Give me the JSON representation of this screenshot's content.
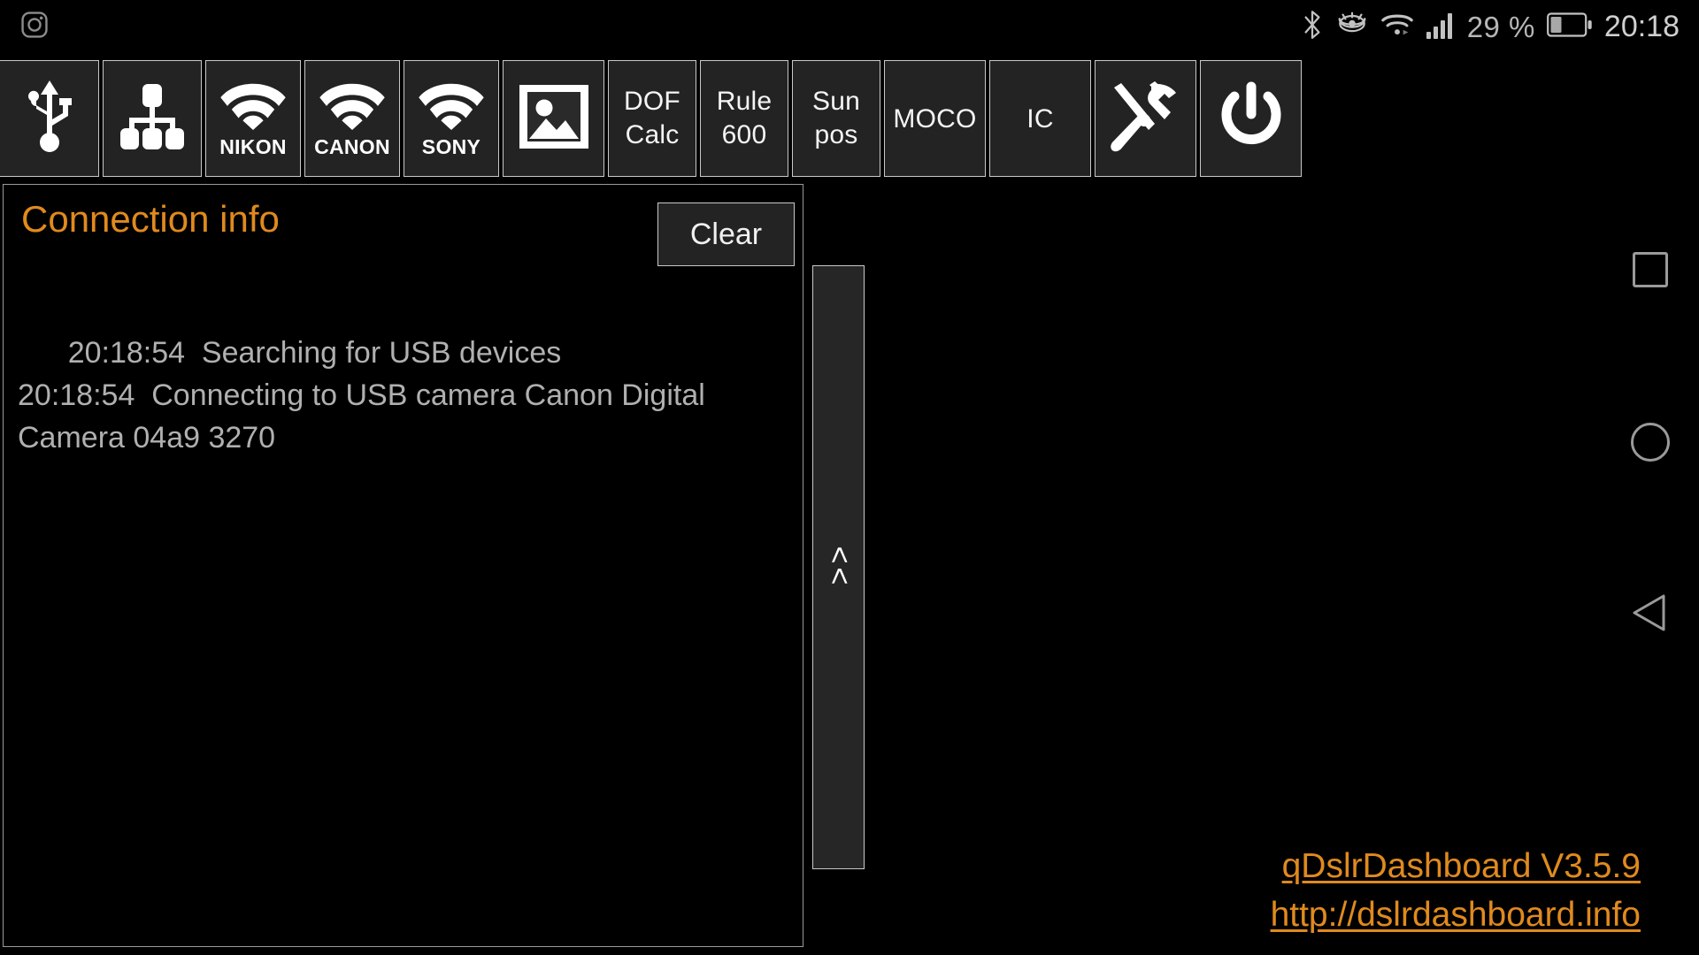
{
  "statusbar": {
    "left_icons": [
      {
        "name": "instagram-icon",
        "glyph": "instagram"
      }
    ],
    "right_icons": [
      {
        "name": "bluetooth-icon",
        "glyph": "bluetooth"
      },
      {
        "name": "eye-comfort-icon",
        "glyph": "eye"
      },
      {
        "name": "wifi-icon",
        "glyph": "wifi"
      },
      {
        "name": "signal-bars-icon",
        "glyph": "signal"
      }
    ],
    "battery_percent": "29 %",
    "battery_level": 29,
    "time": "20:18"
  },
  "toolbar": {
    "buttons": [
      {
        "id": "usb",
        "label": "",
        "icon": "usb-icon",
        "type": "icon"
      },
      {
        "id": "network",
        "label": "",
        "icon": "network-tree-icon",
        "type": "icon"
      },
      {
        "id": "nikon-wifi",
        "label": "NIKON",
        "icon": "wifi-icon",
        "type": "brand"
      },
      {
        "id": "canon-wifi",
        "label": "CANON",
        "icon": "wifi-icon",
        "type": "brand"
      },
      {
        "id": "sony-wifi",
        "label": "SONY",
        "icon": "wifi-icon",
        "type": "brand"
      },
      {
        "id": "gallery",
        "label": "",
        "icon": "image-icon",
        "type": "icon"
      },
      {
        "id": "dof-calc",
        "label": "DOF\nCalc",
        "line1": "DOF",
        "line2": "Calc",
        "type": "text2"
      },
      {
        "id": "rule-600",
        "label": "Rule\n600",
        "line1": "Rule",
        "line2": "600",
        "type": "text2"
      },
      {
        "id": "sun-pos",
        "label": "Sun\npos",
        "line1": "Sun",
        "line2": "pos",
        "type": "text2"
      },
      {
        "id": "moco",
        "label": "MOCO",
        "type": "text1"
      },
      {
        "id": "ic",
        "label": "IC",
        "type": "text1"
      },
      {
        "id": "tools",
        "label": "",
        "icon": "tools-icon",
        "type": "icon"
      },
      {
        "id": "power",
        "label": "",
        "icon": "power-icon",
        "type": "icon"
      }
    ],
    "labels": {
      "nikon": "NIKON",
      "canon": "CANON",
      "sony": "SONY",
      "dof_line1": "DOF",
      "dof_line2": "Calc",
      "rule_line1": "Rule",
      "rule_line2": "600",
      "sun_line1": "Sun",
      "sun_line2": "pos",
      "moco": "MOCO",
      "ic": "IC"
    }
  },
  "panel": {
    "title": "Connection info",
    "clear_label": "Clear",
    "log_lines": [
      "20:18:54  Searching for USB devices",
      "20:18:54  Connecting to USB camera Canon Digital Camera 04a9 3270"
    ],
    "log_text": "20:18:54  Searching for USB devices\n20:18:54  Connecting to USB camera Canon Digital Camera 04a9 3270"
  },
  "collapse_handle": {
    "glyph": "<<"
  },
  "footer": {
    "app_version": "qDslrDashboard V3.5.9",
    "website": "http://dslrdashboard.info"
  },
  "navbar": {
    "recents": "recents-square",
    "home": "home-circle",
    "back": "back-triangle"
  },
  "colors": {
    "accent_orange": "#e08a1e",
    "button_bg": "#232323",
    "button_border": "#c9c9c9",
    "log_text": "#b0b0b0",
    "background": "#000000",
    "nav_icon": "#9a9a9a"
  }
}
